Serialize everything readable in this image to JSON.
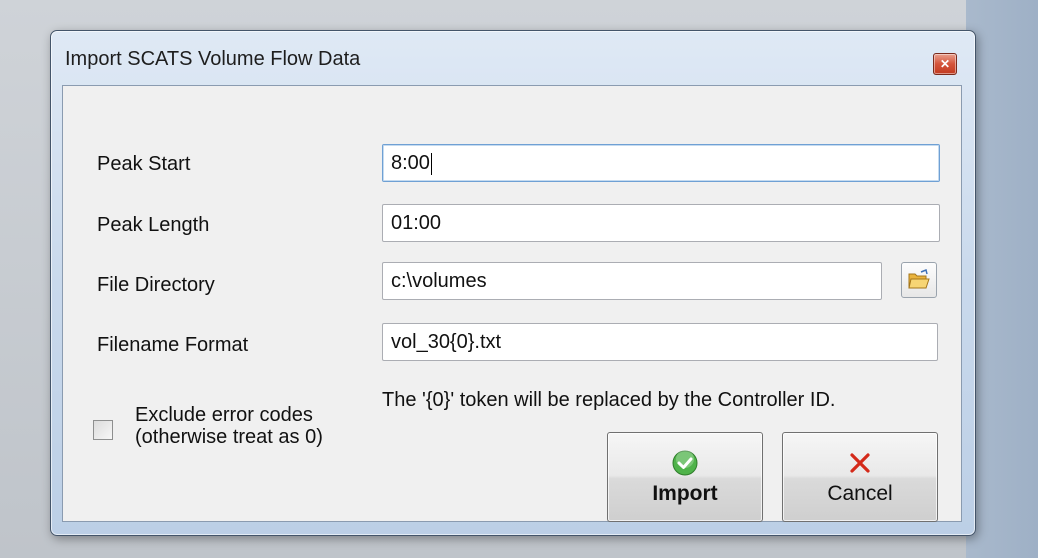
{
  "window": {
    "title": "Import SCATS Volume Flow Data"
  },
  "form": {
    "peak_start": {
      "label": "Peak Start",
      "value": "8:00"
    },
    "peak_length": {
      "label": "Peak Length",
      "value": "01:00"
    },
    "file_directory": {
      "label": "File Directory",
      "value": "c:\\volumes"
    },
    "filename_format": {
      "label": "Filename Format",
      "value": "vol_30{0}.txt"
    },
    "hint": "The '{0}' token will be replaced by the Controller ID.",
    "exclude_errors": {
      "line1": "Exclude error codes",
      "line2": "(otherwise treat as 0)",
      "checked": false
    }
  },
  "buttons": {
    "import_label": "Import",
    "cancel_label": "Cancel"
  },
  "icons": {
    "close": "close-icon",
    "folder": "folder-icon",
    "import": "checkmark-icon",
    "cancel": "x-icon"
  }
}
